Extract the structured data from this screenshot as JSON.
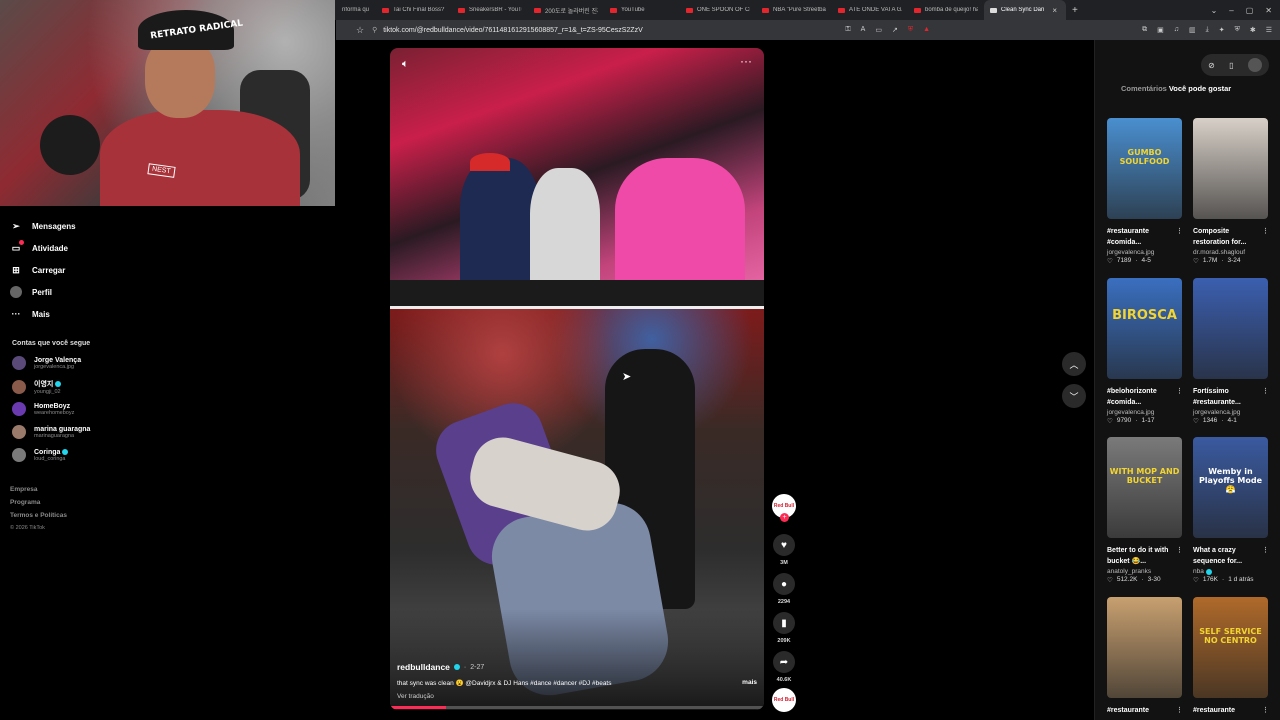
{
  "browser": {
    "tabs": [
      {
        "label": "nforma qu"
      },
      {
        "label": "Tai Chi Final Boss? Push"
      },
      {
        "label": "SneakersBR - YouTube"
      },
      {
        "label": "200도로 놀라버린 진짜"
      },
      {
        "label": "YouTube"
      },
      {
        "label": "ONE SPOON OF CHOC"
      },
      {
        "label": "NBA \"Pure Streetball\""
      },
      {
        "label": "ATÉ ONDE VAI A GANÂ"
      },
      {
        "label": "bomba de queijo! ham"
      },
      {
        "label": "Clean Sync Dan"
      }
    ],
    "url": "tiktok.com/@redbulldance/video/7611481612915608857_r=1&_t=ZS-95CeszS2ZzV"
  },
  "webcam": {
    "cap_text": "RETRATO RADICAL",
    "shirt_logo": "NEST"
  },
  "sidebar": {
    "nav": [
      {
        "label": "Mensagens",
        "icon": "send-icon"
      },
      {
        "label": "Atividade",
        "icon": "inbox-icon"
      },
      {
        "label": "Carregar",
        "icon": "upload-icon"
      },
      {
        "label": "Perfil",
        "icon": "avatar-icon"
      },
      {
        "label": "Mais",
        "icon": "more-icon"
      }
    ],
    "following_title": "Contas que você segue",
    "accounts": [
      {
        "name": "Jorge Valença",
        "username": "jorgevalenca.jpg",
        "verified": false,
        "color": "#5a4a7a"
      },
      {
        "name": "이영지",
        "username": "youngji_02",
        "verified": true,
        "color": "#8a5a4a"
      },
      {
        "name": "HomeBoyz",
        "username": "wearehomeboyz",
        "verified": false,
        "color": "#6a3ab0"
      },
      {
        "name": "marina guaragna",
        "username": "marinaguaragna",
        "verified": false,
        "color": "#9a7a6a"
      },
      {
        "name": "Coringa",
        "username": "loud_coringa",
        "verified": true,
        "color": "#7a7a7a"
      }
    ],
    "footer": {
      "company": "Empresa",
      "program": "Programa",
      "terms": "Termos e Políticas",
      "copyright": "© 2026 TikTok"
    }
  },
  "video": {
    "author": "redbulldance",
    "date": "2-27",
    "description": "that sync was clean 😮 @Davidjrx & DJ Hans #dance #dancer #DJ #beats",
    "more_label": "mais",
    "translate_label": "Ver tradução",
    "progress_percent": 15
  },
  "actions": {
    "avatar_text": "Red Bull",
    "likes": "3M",
    "comments": "2294",
    "saves": "209K",
    "shares": "40.6K"
  },
  "right_panel": {
    "tabs": [
      {
        "label": "Comentários",
        "active": false
      },
      {
        "label": "Você pode gostar",
        "active": true
      }
    ],
    "cards": [
      {
        "title": "#restaurante #comida...",
        "author": "jorgevalenca.jpg",
        "likes": "7189",
        "date": "4-5",
        "thumb_text": "GUMBO SOULFOOD",
        "bg": "#4a8fd0",
        "fg": "#f2d531",
        "verified": false
      },
      {
        "title": "Composite restoration for...",
        "author": "dr.morad.shaglouf",
        "likes": "1.7M",
        "date": "3-24",
        "thumb_text": "",
        "bg": "#d8d0c8",
        "fg": "#fff",
        "verified": false
      },
      {
        "title": "#belohorizonte #comida...",
        "author": "jorgevalenca.jpg",
        "likes": "9790",
        "date": "1-17",
        "thumb_text": "BIROSCA",
        "bg": "#3a6fc0",
        "fg": "#f2d531",
        "verified": false
      },
      {
        "title": "Fortíssimo #restaurante...",
        "author": "jorgevalenca.jpg",
        "likes": "1346",
        "date": "4-1",
        "thumb_text": "",
        "bg": "#3b5fb0",
        "fg": "#fff",
        "verified": false
      },
      {
        "title": "Better to do it with bucket 😂...",
        "author": "anatoly_pranks",
        "likes": "512.2K",
        "date": "3-30",
        "thumb_text": "WITH MOP AND BUCKET",
        "bg": "#7a7a7a",
        "fg": "#f2d531",
        "verified": false
      },
      {
        "title": "What a crazy sequence for...",
        "author": "nba",
        "likes": "176K",
        "date": "1 d atrás",
        "thumb_text": "Wemby in Playoffs Mode 😤",
        "bg": "#3a5aa0",
        "fg": "#fff",
        "verified": true
      },
      {
        "title": "#restaurante",
        "author": "",
        "likes": "",
        "date": "",
        "thumb_text": "",
        "bg": "#c8a070",
        "fg": "#fff",
        "verified": false
      },
      {
        "title": "#restaurante",
        "author": "",
        "likes": "",
        "date": "",
        "thumb_text": "SELF SERVICE NO CENTRO",
        "bg": "#b06a2a",
        "fg": "#f2d531",
        "verified": false
      }
    ]
  }
}
